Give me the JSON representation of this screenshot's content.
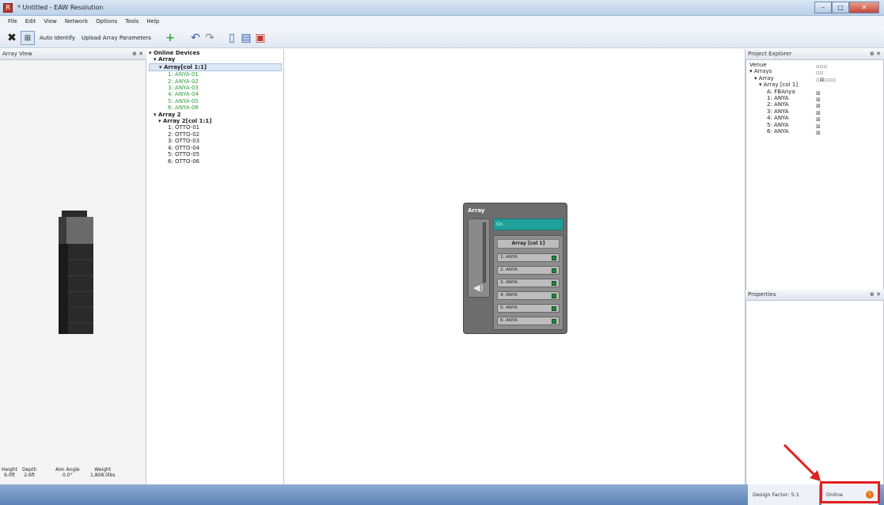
{
  "window": {
    "title": "* Untitled - EAW Resolution"
  },
  "menu": [
    "File",
    "Edit",
    "View",
    "Network",
    "Options",
    "Tools",
    "Help"
  ],
  "toolbar": {
    "auto_identify": "Auto Identify",
    "upload": "Upload Array Parameters"
  },
  "array_view": {
    "title": "Array View",
    "stats": [
      {
        "label": "Height",
        "value": "9.0ft"
      },
      {
        "label": "Depth",
        "value": "2.6ft"
      },
      {
        "label": "Aim Angle",
        "value": "0.0°"
      },
      {
        "label": "Weight",
        "value": "1,808.0lbs"
      }
    ]
  },
  "online_devices": {
    "root": "Online Devices",
    "groups": [
      {
        "name": "Array",
        "sub": "Array[col 1:1]",
        "items": [
          "1: ANYA-01",
          "2: ANYA-02",
          "3: ANYA-03",
          "4: ANYA-04",
          "5: ANYA-05",
          "6: ANYA-06"
        ]
      },
      {
        "name": "Array 2",
        "sub": "Array 2[col 1:1]",
        "items": [
          "1: OTTO-01",
          "2: OTTO-02",
          "3: OTTO-03",
          "4: OTTO-04",
          "5: OTTO-05",
          "6: OTTO-06"
        ]
      }
    ]
  },
  "array_widget": {
    "title": "Array",
    "teal_label": "On",
    "sub_title": "Array [col 1]",
    "units": [
      "1: ANYA",
      "2: ANYA",
      "3: ANYA",
      "4: ANYA",
      "5: ANYA",
      "6: ANYA"
    ]
  },
  "project_explorer": {
    "title": "Project Explorer",
    "rows": [
      "Venue",
      "Arrays",
      "Array",
      "Array [col 1]",
      "A: FBAnya",
      "1: ANYA",
      "2: ANYA",
      "3: ANYA",
      "4: ANYA",
      "5: ANYA",
      "6: ANYA"
    ]
  },
  "properties": {
    "title": "Properties"
  },
  "status": {
    "design_factor": "Design Factor: 5:1",
    "online": "Online"
  }
}
